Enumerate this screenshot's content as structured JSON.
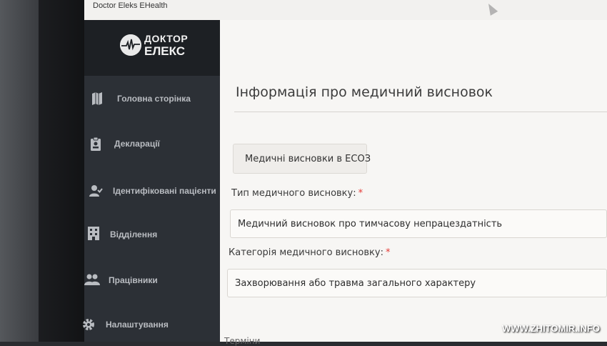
{
  "window": {
    "title": "Doctor Eleks EHealth"
  },
  "logo": {
    "line1": "ДОКТОР",
    "line2": "ЕЛЕКС"
  },
  "sidebar": {
    "items": [
      {
        "label": "Головна сторінка",
        "icon": "map-icon"
      },
      {
        "label": "Декларації",
        "icon": "clipboard-icon"
      },
      {
        "label": "Ідентифіковані пацієнти",
        "icon": "user-check-icon"
      },
      {
        "label": "Відділення",
        "icon": "building-icon"
      },
      {
        "label": "Працівники",
        "icon": "users-icon"
      },
      {
        "label": "Налаштування",
        "icon": "gear-icon"
      }
    ]
  },
  "main": {
    "title": "Інформація про медичний висновок",
    "chip": "Медичні висновки в ЕСОЗ",
    "fields": [
      {
        "label": "Тип медичного висновку:",
        "value": "Медичний висновок про тимчасову непрацездатність",
        "required": "*"
      },
      {
        "label": "Категорія медичного висновку:",
        "value": "Захворювання або травма загального характеру",
        "required": "*"
      }
    ],
    "next_label_partial": "Терміни"
  },
  "watermark": "WWW.ZHITOMIR.INFO",
  "colors": {
    "sidebar_bg": "#2c3036",
    "logo_bg": "#1d2024",
    "required": "#e53935"
  }
}
